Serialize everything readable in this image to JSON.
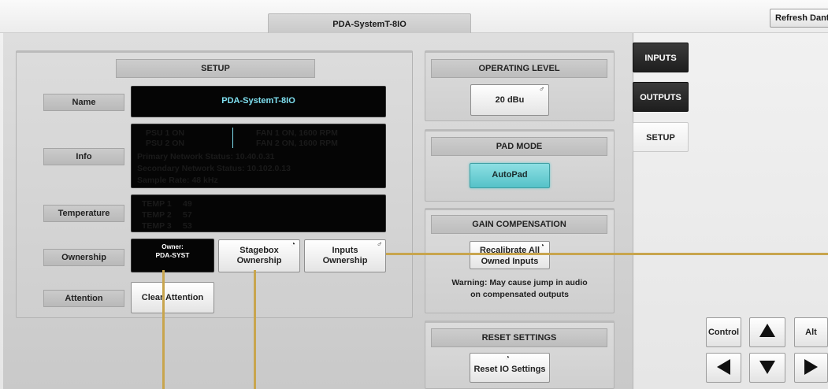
{
  "topbar": {
    "device_tab": "PDA-SystemT-8IO",
    "refresh_button": "Refresh Dante"
  },
  "setup": {
    "title": "SETUP",
    "name_label": "Name",
    "name_value": "PDA-SystemT-8IO",
    "info_label": "Info",
    "info": {
      "psu1": "PSU 1  ON",
      "psu2": "PSU 2  ON",
      "fan1": "FAN 1 ON, 1600 RPM",
      "fan2": "FAN 2 ON, 1600 RPM",
      "primary": "Primary Network Status:  10.40.0.31",
      "secondary": "Secondary Network Status:  10.102.0.13",
      "sample_rate": "Sample Rate:  48 kHz"
    },
    "temperature_label": "Temperature",
    "temps": [
      {
        "label": "TEMP 1",
        "value": "49"
      },
      {
        "label": "TEMP 2",
        "value": "57"
      },
      {
        "label": "TEMP 3",
        "value": "53"
      }
    ],
    "ownership_label": "Ownership",
    "owner_title": "Owner:",
    "owner_value": "PDA-SYST",
    "stagebox_line1": "Stagebox",
    "stagebox_line2": "Ownership",
    "inputs_line1": "Inputs",
    "inputs_line2": "Ownership",
    "attention_label": "Attention",
    "clear_attention": "Clear Attention"
  },
  "operating_level": {
    "title": "OPERATING LEVEL",
    "value": "20 dBu"
  },
  "pad_mode": {
    "title": "PAD MODE",
    "value": "AutoPad"
  },
  "gain_compensation": {
    "title": "GAIN COMPENSATION",
    "button_line1": "Recalibrate All",
    "button_line2": "Owned Inputs",
    "warning_line1": "Warning: May cause jump in audio",
    "warning_line2": "on compensated outputs"
  },
  "reset_settings": {
    "title": "RESET SETTINGS",
    "button": "Reset IO Settings"
  },
  "nav": {
    "inputs": "INPUTS",
    "outputs": "OUTPUTS",
    "setup": "SETUP"
  },
  "keys": {
    "control": "Control",
    "alt": "Alt"
  },
  "colors": {
    "screen_text": "#7fe0f0",
    "autopad": "#55c2c8",
    "guide_line": "#c8a54e"
  }
}
